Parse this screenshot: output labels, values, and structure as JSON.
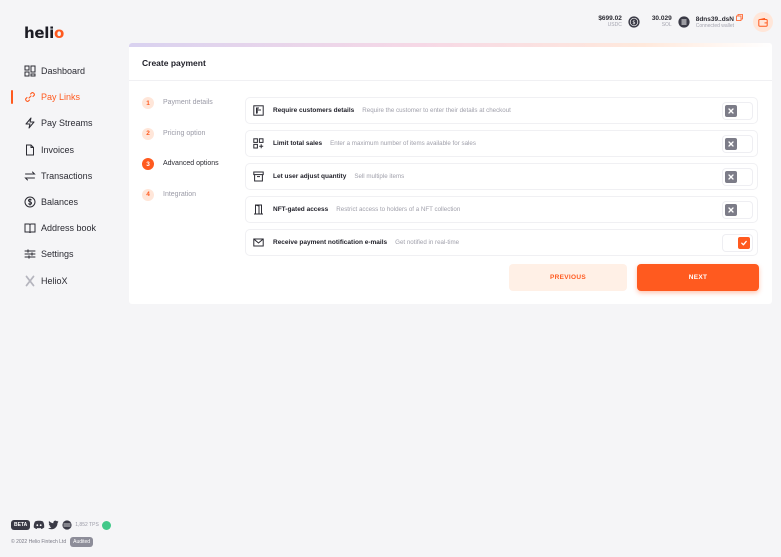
{
  "brand": {
    "logo_main": "heli",
    "logo_accent": "o",
    "accent_color": "#ff5a1f"
  },
  "sidebar": {
    "items": [
      {
        "label": "Dashboard",
        "icon": "dashboard-icon",
        "active": false
      },
      {
        "label": "Pay Links",
        "icon": "link-icon",
        "active": true
      },
      {
        "label": "Pay Streams",
        "icon": "lightning-icon",
        "active": false
      },
      {
        "label": "Invoices",
        "icon": "document-icon",
        "active": false
      },
      {
        "label": "Transactions",
        "icon": "arrows-icon",
        "active": false
      },
      {
        "label": "Balances",
        "icon": "dollar-coin-icon",
        "active": false
      },
      {
        "label": "Address book",
        "icon": "book-icon",
        "active": false
      },
      {
        "label": "Settings",
        "icon": "sliders-icon",
        "active": false
      },
      {
        "label": "HelioX",
        "icon": "x-icon",
        "active": false
      }
    ]
  },
  "footer": {
    "beta": "BETA",
    "tps": "1,852 TPS",
    "copyright": "© 2022 Helio Fintech Ltd",
    "audited": "Audited"
  },
  "topbar": {
    "usdc_amount": "$699.02",
    "usdc_label": "USDC",
    "sol_amount": "30.029",
    "sol_label": "SOL",
    "wallet_address": "8dns39..dsN",
    "wallet_status": "Connected wallet"
  },
  "card": {
    "title": "Create payment",
    "steps": [
      {
        "num": "1",
        "label": "Payment details",
        "active": false
      },
      {
        "num": "2",
        "label": "Pricing option",
        "active": false
      },
      {
        "num": "3",
        "label": "Advanced options",
        "active": true
      },
      {
        "num": "4",
        "label": "Integration",
        "active": false
      }
    ],
    "options": [
      {
        "title": "Require customers details",
        "desc": "Require the customer to enter their details at checkout",
        "icon": "form-icon",
        "enabled": false
      },
      {
        "title": "Limit total sales",
        "desc": "Enter a maximum number of items available for sales",
        "icon": "grid-plus-icon",
        "enabled": false
      },
      {
        "title": "Let user adjust quantity",
        "desc": "Sell multiple items",
        "icon": "archive-icon",
        "enabled": false
      },
      {
        "title": "NFT-gated access",
        "desc": "Restrict access to holders of a NFT collection",
        "icon": "door-icon",
        "enabled": false
      },
      {
        "title": "Receive payment notification e-mails",
        "desc": "Get notified in real-time",
        "icon": "mail-icon",
        "enabled": true
      }
    ],
    "prev_label": "PREVIOUS",
    "next_label": "NEXT"
  }
}
